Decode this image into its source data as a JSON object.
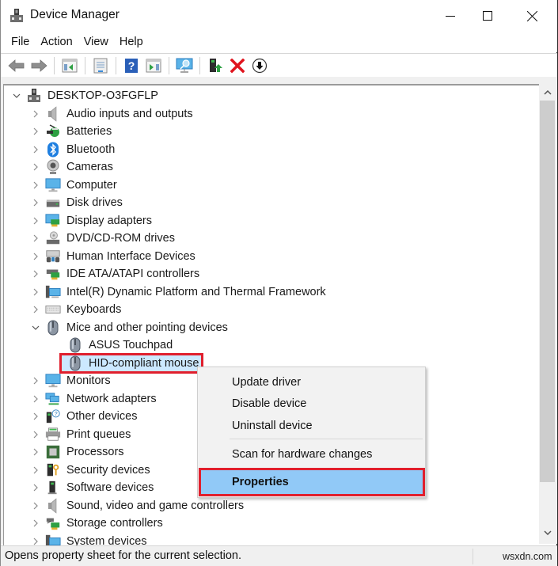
{
  "window": {
    "title": "Device Manager",
    "controls": {
      "minimize": "minimize",
      "maximize": "maximize",
      "close": "close"
    }
  },
  "menubar": {
    "items": [
      "File",
      "Action",
      "View",
      "Help"
    ]
  },
  "toolbar": {
    "buttons": [
      {
        "name": "back",
        "icon": "back-arrow-icon"
      },
      {
        "name": "forward",
        "icon": "forward-arrow-icon"
      },
      {
        "name": "show-hide-console-tree",
        "icon": "console-tree-icon"
      },
      {
        "name": "properties",
        "icon": "properties-sheet-icon"
      },
      {
        "name": "help",
        "icon": "help-icon"
      },
      {
        "name": "show-hide-action-pane",
        "icon": "action-pane-icon"
      },
      {
        "name": "scan-hardware-changes",
        "icon": "monitor-scan-icon"
      },
      {
        "name": "update-driver",
        "icon": "update-driver-icon"
      },
      {
        "name": "uninstall-device",
        "icon": "red-x-icon"
      },
      {
        "name": "disable-device",
        "icon": "down-arrow-circle-icon"
      }
    ]
  },
  "tree": {
    "root": {
      "label": "DESKTOP-O3FGFLP",
      "expanded": true,
      "icon": "computer-tower-icon"
    },
    "categories": [
      {
        "label": "Audio inputs and outputs",
        "icon": "speaker-icon",
        "expanded": false
      },
      {
        "label": "Batteries",
        "icon": "battery-icon",
        "expanded": false
      },
      {
        "label": "Bluetooth",
        "icon": "bluetooth-icon",
        "expanded": false
      },
      {
        "label": "Cameras",
        "icon": "webcam-icon",
        "expanded": false
      },
      {
        "label": "Computer",
        "icon": "monitor-icon",
        "expanded": false
      },
      {
        "label": "Disk drives",
        "icon": "disk-drive-icon",
        "expanded": false
      },
      {
        "label": "Display adapters",
        "icon": "display-adapter-icon",
        "expanded": false
      },
      {
        "label": "DVD/CD-ROM drives",
        "icon": "dvd-drive-icon",
        "expanded": false
      },
      {
        "label": "Human Interface Devices",
        "icon": "hid-icon",
        "expanded": false
      },
      {
        "label": "IDE ATA/ATAPI controllers",
        "icon": "ide-controller-icon",
        "expanded": false
      },
      {
        "label": "Intel(R) Dynamic Platform and Thermal Framework",
        "icon": "intel-platform-icon",
        "expanded": false
      },
      {
        "label": "Keyboards",
        "icon": "keyboard-icon",
        "expanded": false
      },
      {
        "label": "Mice and other pointing devices",
        "icon": "mouse-icon",
        "expanded": true,
        "children": [
          {
            "label": "ASUS Touchpad",
            "icon": "mouse-icon",
            "selected": false
          },
          {
            "label": "HID-compliant mouse",
            "icon": "mouse-icon",
            "selected": true
          }
        ]
      },
      {
        "label": "Monitors",
        "icon": "monitor-icon",
        "expanded": false
      },
      {
        "label": "Network adapters",
        "icon": "network-adapter-icon",
        "expanded": false
      },
      {
        "label": "Other devices",
        "icon": "other-device-icon",
        "expanded": false
      },
      {
        "label": "Print queues",
        "icon": "printer-icon",
        "expanded": false
      },
      {
        "label": "Processors",
        "icon": "processor-icon",
        "expanded": false
      },
      {
        "label": "Security devices",
        "icon": "security-device-icon",
        "expanded": false
      },
      {
        "label": "Software devices",
        "icon": "software-device-icon",
        "expanded": false
      },
      {
        "label": "Sound, video and game controllers",
        "icon": "speaker-icon",
        "expanded": false
      },
      {
        "label": "Storage controllers",
        "icon": "storage-controller-icon",
        "expanded": false
      },
      {
        "label": "System devices",
        "icon": "system-device-icon",
        "expanded": false
      }
    ]
  },
  "context_menu": {
    "items": [
      {
        "label": "Update driver"
      },
      {
        "label": "Disable device"
      },
      {
        "label": "Uninstall device"
      },
      {
        "separator": true
      },
      {
        "label": "Scan for hardware changes"
      },
      {
        "separator": true
      },
      {
        "label": "Properties",
        "default": true,
        "highlighted": true
      }
    ]
  },
  "scrollbar": {
    "position_fraction": 0.0,
    "visible_fraction": 0.9
  },
  "statusbar": {
    "text": "Opens property sheet for the current selection.",
    "watermark": "wsxdn.com"
  },
  "colors": {
    "selection_bg": "#cce8ff",
    "menu_highlight_bg": "#91c9f7",
    "annotation_red": "#e01f2d"
  }
}
